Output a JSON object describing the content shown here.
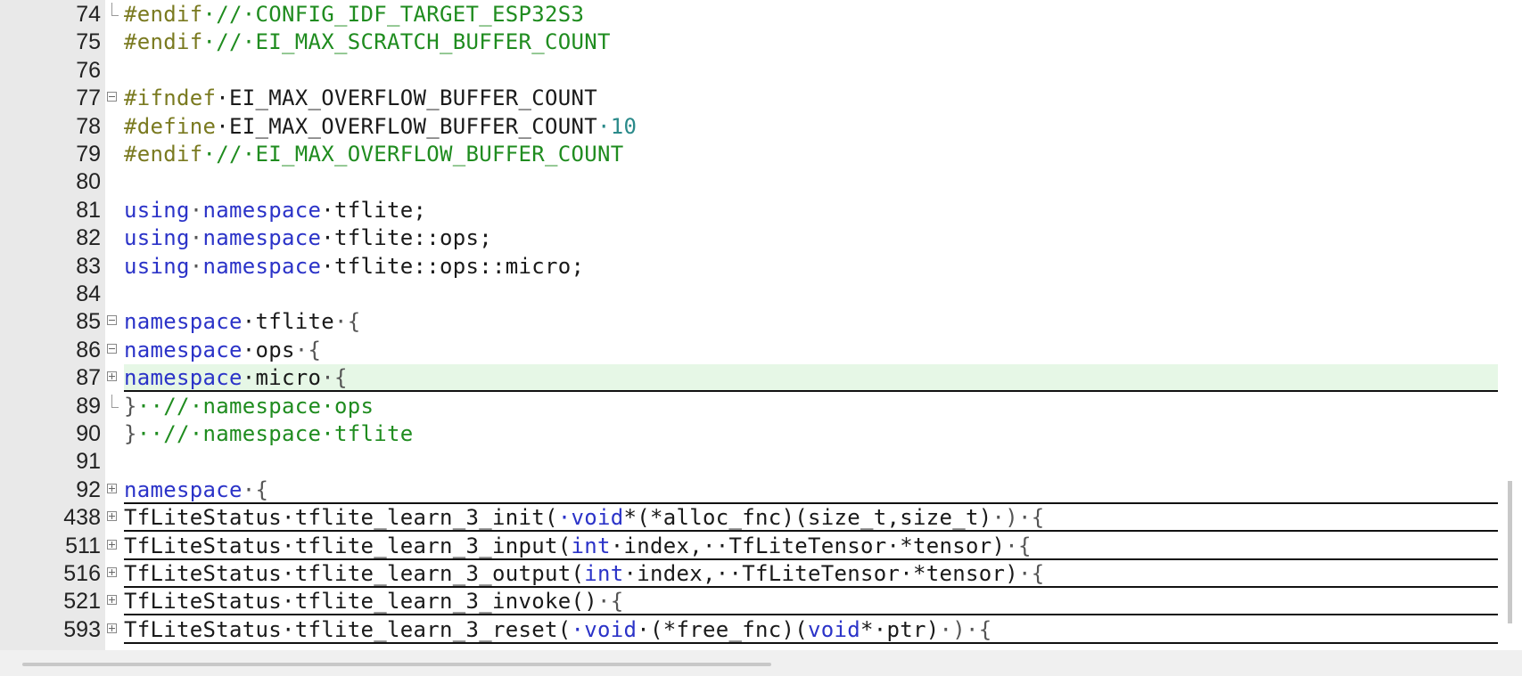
{
  "editor": {
    "lines": [
      {
        "num": "74",
        "fold": "corner",
        "parts": [
          [
            "pp",
            "#endif"
          ],
          [
            "cm",
            "·//·CONFIG_IDF_TARGET_ESP32S3"
          ]
        ]
      },
      {
        "num": "75",
        "fold": "",
        "parts": [
          [
            "pp",
            "#endif"
          ],
          [
            "cm",
            "·//·EI_MAX_SCRATCH_BUFFER_COUNT"
          ]
        ]
      },
      {
        "num": "76",
        "fold": "",
        "parts": []
      },
      {
        "num": "77",
        "fold": "minus",
        "parts": [
          [
            "pp",
            "#ifndef"
          ],
          [
            "",
            "·EI_MAX_OVERFLOW_BUFFER_COUNT"
          ]
        ]
      },
      {
        "num": "78",
        "fold": "",
        "parts": [
          [
            "pp",
            "#define"
          ],
          [
            "",
            "·EI_MAX_OVERFLOW_BUFFER_COUNT"
          ],
          [
            "num",
            "·10"
          ]
        ]
      },
      {
        "num": "79",
        "fold": "",
        "parts": [
          [
            "pp",
            "#endif"
          ],
          [
            "cm",
            "·//·EI_MAX_OVERFLOW_BUFFER_COUNT"
          ]
        ]
      },
      {
        "num": "80",
        "fold": "",
        "parts": []
      },
      {
        "num": "81",
        "fold": "",
        "parts": [
          [
            "kw",
            "using"
          ],
          [
            "br",
            "·"
          ],
          [
            "kw",
            "namespace"
          ],
          [
            "",
            "·tflite;"
          ]
        ]
      },
      {
        "num": "82",
        "fold": "",
        "parts": [
          [
            "kw",
            "using"
          ],
          [
            "br",
            "·"
          ],
          [
            "kw",
            "namespace"
          ],
          [
            "",
            "·tflite::ops;"
          ]
        ]
      },
      {
        "num": "83",
        "fold": "",
        "parts": [
          [
            "kw",
            "using"
          ],
          [
            "br",
            "·"
          ],
          [
            "kw",
            "namespace"
          ],
          [
            "",
            "·tflite::ops::micro;"
          ]
        ]
      },
      {
        "num": "84",
        "fold": "",
        "parts": []
      },
      {
        "num": "85",
        "fold": "minus",
        "parts": [
          [
            "kw",
            "namespace"
          ],
          [
            "",
            "·tflite"
          ],
          [
            "br",
            "·{"
          ]
        ]
      },
      {
        "num": "86",
        "fold": "minus",
        "parts": [
          [
            "kw",
            "namespace"
          ],
          [
            "",
            "·ops"
          ],
          [
            "br",
            "·{"
          ]
        ]
      },
      {
        "num": "87",
        "fold": "plus",
        "highlight": true,
        "underline": true,
        "parts": [
          [
            "kw",
            "namespace"
          ],
          [
            "",
            "·micro"
          ],
          [
            "br",
            "·{"
          ]
        ]
      },
      {
        "num": "89",
        "fold": "corner",
        "parts": [
          [
            "br",
            "}"
          ],
          [
            "cm",
            "··//·namespace·ops"
          ]
        ]
      },
      {
        "num": "90",
        "fold": "",
        "parts": [
          [
            "br",
            "}"
          ],
          [
            "cm",
            "··//·namespace·tflite"
          ]
        ]
      },
      {
        "num": "91",
        "fold": "",
        "parts": []
      },
      {
        "num": "92",
        "fold": "plus",
        "underline": true,
        "parts": [
          [
            "kw",
            "namespace"
          ],
          [
            "br",
            "·{"
          ]
        ]
      },
      {
        "num": "438",
        "fold": "plus",
        "underline": true,
        "parts": [
          [
            "",
            "TfLiteStatus·tflite_learn_3_init("
          ],
          [
            "kw",
            "·void"
          ],
          [
            "",
            "*(*alloc_fnc)(size_t,size_t)"
          ],
          [
            "br",
            "·)·{"
          ]
        ]
      },
      {
        "num": "511",
        "fold": "plus",
        "underline": true,
        "parts": [
          [
            "",
            "TfLiteStatus·tflite_learn_3_input("
          ],
          [
            "kw",
            "int"
          ],
          [
            "",
            "·index,··TfLiteTensor·*tensor)"
          ],
          [
            "br",
            "·{"
          ]
        ]
      },
      {
        "num": "516",
        "fold": "plus",
        "underline": true,
        "parts": [
          [
            "",
            "TfLiteStatus·tflite_learn_3_output("
          ],
          [
            "kw",
            "int"
          ],
          [
            "",
            "·index,··TfLiteTensor·*tensor)"
          ],
          [
            "br",
            "·{"
          ]
        ]
      },
      {
        "num": "521",
        "fold": "plus",
        "underline": true,
        "parts": [
          [
            "",
            "TfLiteStatus·tflite_learn_3_invoke()"
          ],
          [
            "br",
            "·{"
          ]
        ]
      },
      {
        "num": "593",
        "fold": "plus",
        "underline": true,
        "parts": [
          [
            "",
            "TfLiteStatus·tflite_learn_3_reset("
          ],
          [
            "kw",
            "·void"
          ],
          [
            "",
            "·(*free_fnc)("
          ],
          [
            "kw",
            "void"
          ],
          [
            "",
            "*·ptr)"
          ],
          [
            "br",
            "·)·{"
          ]
        ]
      }
    ]
  }
}
